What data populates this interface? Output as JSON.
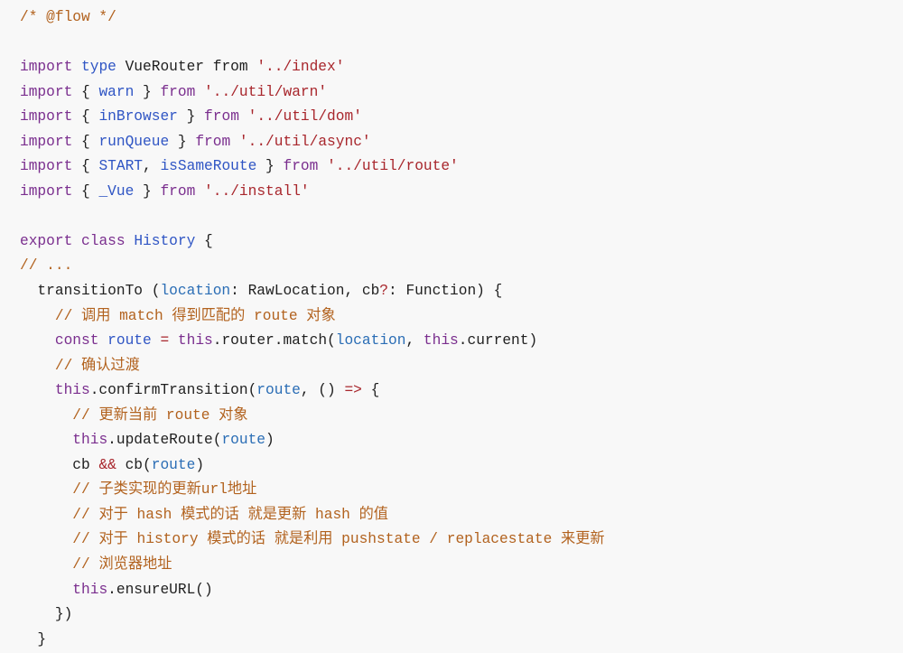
{
  "code": {
    "language": "javascript",
    "lines": [
      [
        {
          "t": "/* @flow */",
          "c": "cm"
        }
      ],
      [],
      [
        {
          "t": "import",
          "c": "kw"
        },
        {
          "t": " "
        },
        {
          "t": "type",
          "c": "ty"
        },
        {
          "t": " VueRouter from "
        },
        {
          "t": "'../index'",
          "c": "str"
        }
      ],
      [
        {
          "t": "import",
          "c": "kw"
        },
        {
          "t": " { "
        },
        {
          "t": "warn",
          "c": "id"
        },
        {
          "t": " } "
        },
        {
          "t": "from",
          "c": "kw"
        },
        {
          "t": " "
        },
        {
          "t": "'../util/warn'",
          "c": "str"
        }
      ],
      [
        {
          "t": "import",
          "c": "kw"
        },
        {
          "t": " { "
        },
        {
          "t": "inBrowser",
          "c": "id"
        },
        {
          "t": " } "
        },
        {
          "t": "from",
          "c": "kw"
        },
        {
          "t": " "
        },
        {
          "t": "'../util/dom'",
          "c": "str"
        }
      ],
      [
        {
          "t": "import",
          "c": "kw"
        },
        {
          "t": " { "
        },
        {
          "t": "runQueue",
          "c": "id"
        },
        {
          "t": " } "
        },
        {
          "t": "from",
          "c": "kw"
        },
        {
          "t": " "
        },
        {
          "t": "'../util/async'",
          "c": "str"
        }
      ],
      [
        {
          "t": "import",
          "c": "kw"
        },
        {
          "t": " { "
        },
        {
          "t": "START",
          "c": "id"
        },
        {
          "t": ", "
        },
        {
          "t": "isSameRoute",
          "c": "id"
        },
        {
          "t": " } "
        },
        {
          "t": "from",
          "c": "kw"
        },
        {
          "t": " "
        },
        {
          "t": "'../util/route'",
          "c": "str"
        }
      ],
      [
        {
          "t": "import",
          "c": "kw"
        },
        {
          "t": " { "
        },
        {
          "t": "_Vue",
          "c": "id"
        },
        {
          "t": " } "
        },
        {
          "t": "from",
          "c": "kw"
        },
        {
          "t": " "
        },
        {
          "t": "'../install'",
          "c": "str"
        }
      ],
      [],
      [
        {
          "t": "export",
          "c": "kw"
        },
        {
          "t": " "
        },
        {
          "t": "class",
          "c": "kw"
        },
        {
          "t": " "
        },
        {
          "t": "History",
          "c": "id"
        },
        {
          "t": " {"
        }
      ],
      [
        {
          "t": "// ...",
          "c": "cm"
        }
      ],
      [
        {
          "t": "  transitionTo ("
        },
        {
          "t": "location",
          "c": "var"
        },
        {
          "t": ": RawLocation, cb"
        },
        {
          "t": "?",
          "c": "op"
        },
        {
          "t": ": Function) {"
        }
      ],
      [
        {
          "t": "    "
        },
        {
          "t": "// 调用 match 得到匹配的 route 对象",
          "c": "cm"
        }
      ],
      [
        {
          "t": "    "
        },
        {
          "t": "const",
          "c": "kw"
        },
        {
          "t": " "
        },
        {
          "t": "route",
          "c": "id"
        },
        {
          "t": " "
        },
        {
          "t": "=",
          "c": "op"
        },
        {
          "t": " "
        },
        {
          "t": "this",
          "c": "kw"
        },
        {
          "t": ".router.match("
        },
        {
          "t": "location",
          "c": "var"
        },
        {
          "t": ", "
        },
        {
          "t": "this",
          "c": "kw"
        },
        {
          "t": ".current)"
        }
      ],
      [
        {
          "t": "    "
        },
        {
          "t": "// 确认过渡",
          "c": "cm"
        }
      ],
      [
        {
          "t": "    "
        },
        {
          "t": "this",
          "c": "kw"
        },
        {
          "t": ".confirmTransition("
        },
        {
          "t": "route",
          "c": "var"
        },
        {
          "t": ", () "
        },
        {
          "t": "=>",
          "c": "op"
        },
        {
          "t": " {"
        }
      ],
      [
        {
          "t": "      "
        },
        {
          "t": "// 更新当前 route 对象",
          "c": "cm"
        }
      ],
      [
        {
          "t": "      "
        },
        {
          "t": "this",
          "c": "kw"
        },
        {
          "t": ".updateRoute("
        },
        {
          "t": "route",
          "c": "var"
        },
        {
          "t": ")"
        }
      ],
      [
        {
          "t": "      cb "
        },
        {
          "t": "&&",
          "c": "op"
        },
        {
          "t": " cb("
        },
        {
          "t": "route",
          "c": "var"
        },
        {
          "t": ")"
        }
      ],
      [
        {
          "t": "      "
        },
        {
          "t": "// 子类实现的更新url地址",
          "c": "cm"
        }
      ],
      [
        {
          "t": "      "
        },
        {
          "t": "// 对于 hash 模式的话 就是更新 hash 的值",
          "c": "cm"
        }
      ],
      [
        {
          "t": "      "
        },
        {
          "t": "// 对于 history 模式的话 就是利用 pushstate / replacestate 来更新",
          "c": "cm"
        }
      ],
      [
        {
          "t": "      "
        },
        {
          "t": "// 浏览器地址",
          "c": "cm"
        }
      ],
      [
        {
          "t": "      "
        },
        {
          "t": "this",
          "c": "kw"
        },
        {
          "t": ".ensureURL()"
        }
      ],
      [
        {
          "t": "    })"
        }
      ],
      [
        {
          "t": "  }"
        }
      ]
    ]
  },
  "colors": {
    "background": "#f8f8f8",
    "keyword": "#7a2e8e",
    "identifier": "#2f55c4",
    "string": "#a8262c",
    "comment": "#b2621e",
    "plain": "#1f1f1f"
  }
}
